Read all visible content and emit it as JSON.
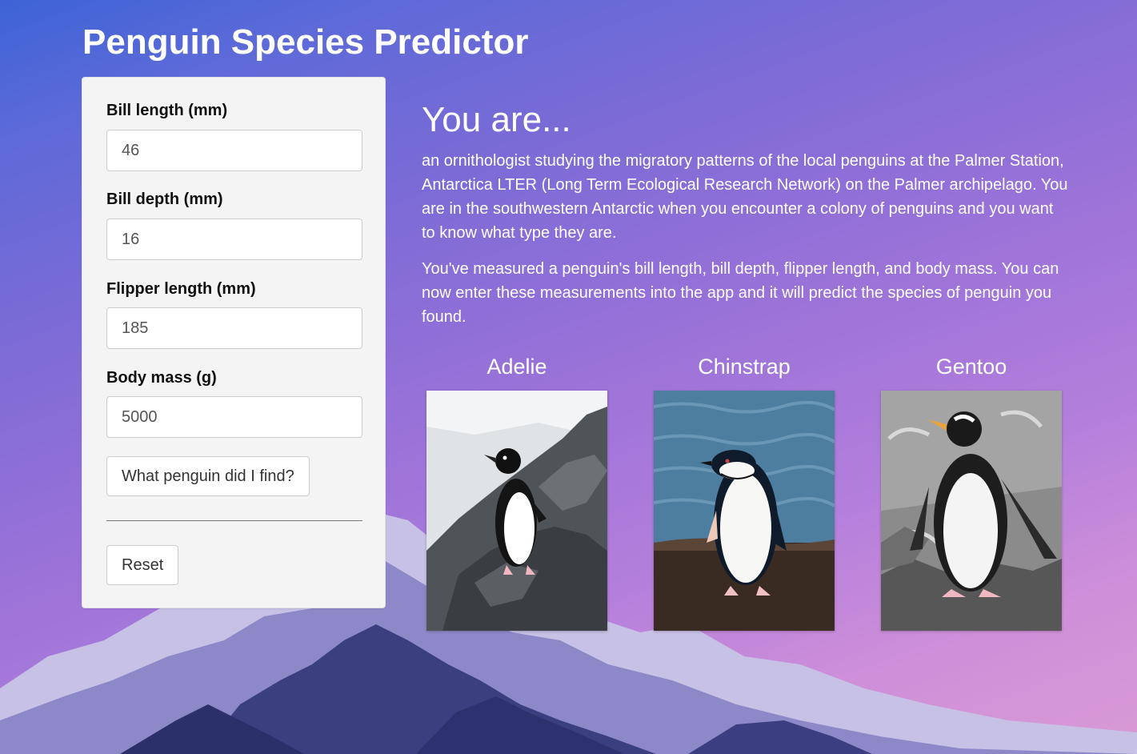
{
  "app": {
    "title": "Penguin Species Predictor"
  },
  "form": {
    "bill_length": {
      "label": "Bill length (mm)",
      "value": "46"
    },
    "bill_depth": {
      "label": "Bill depth (mm)",
      "value": "16"
    },
    "flipper_length": {
      "label": "Flipper length (mm)",
      "value": "185"
    },
    "body_mass": {
      "label": "Body mass (g)",
      "value": "5000"
    },
    "predict_label": "What penguin did I find?",
    "reset_label": "Reset"
  },
  "main": {
    "heading": "You are...",
    "paragraphs": [
      "an ornithologist studying the migratory patterns of the local penguins at the Palmer Station, Antarctica LTER (Long Term Ecological Research Network) on the Palmer archipelago. You are in the southwestern Antarctic when you encounter a colony of penguins and you want to know what type they are.",
      "You've measured a penguin's bill length, bill depth, flipper length, and body mass. You can now enter these measurements into the app and it will predict the species of penguin you found."
    ],
    "species": [
      {
        "name": "Adelie"
      },
      {
        "name": "Chinstrap"
      },
      {
        "name": "Gentoo"
      }
    ]
  },
  "colors": {
    "sky_top": "#3d63d6",
    "sky_bottom": "#d99ad6",
    "panel": "#f4f4f4",
    "text_light": "#ffffff"
  }
}
